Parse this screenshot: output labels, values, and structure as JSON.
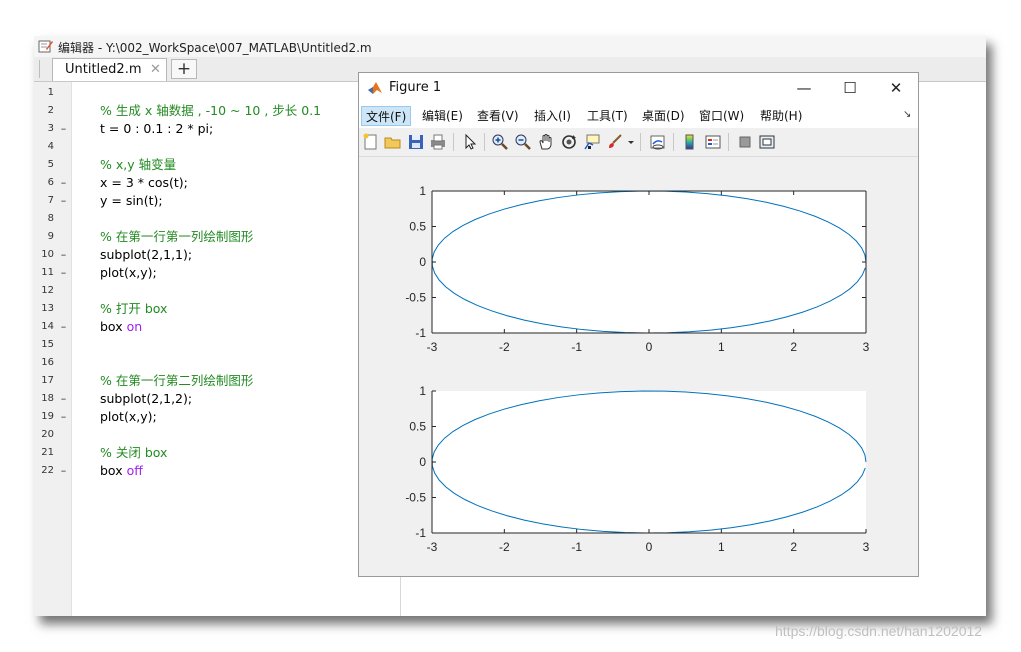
{
  "editor": {
    "title": "编辑器 - Y:\\002_WorkSpace\\007_MATLAB\\Untitled2.m",
    "tab_label": "Untitled2.m",
    "tab_close": "✕",
    "add_tab": "+",
    "lines": [
      {
        "num": "1",
        "mark": "",
        "text": "",
        "kind": "code"
      },
      {
        "num": "2",
        "mark": "",
        "text": "% 生成 x 轴数据 , -10 ~ 10 , 步长 0.1",
        "kind": "comment"
      },
      {
        "num": "3",
        "mark": "–",
        "text": "t = 0 : 0.1 : 2 * pi;",
        "kind": "code"
      },
      {
        "num": "4",
        "mark": "",
        "text": "",
        "kind": "code"
      },
      {
        "num": "5",
        "mark": "",
        "text": "% x,y 轴变量",
        "kind": "comment"
      },
      {
        "num": "6",
        "mark": "–",
        "text": "x = 3 * cos(t);",
        "kind": "code"
      },
      {
        "num": "7",
        "mark": "–",
        "text": "y = sin(t);",
        "kind": "code"
      },
      {
        "num": "8",
        "mark": "",
        "text": "",
        "kind": "code"
      },
      {
        "num": "9",
        "mark": "",
        "text": "% 在第一行第一列绘制图形",
        "kind": "comment"
      },
      {
        "num": "10",
        "mark": "–",
        "text": "subplot(2,1,1);",
        "kind": "code"
      },
      {
        "num": "11",
        "mark": "–",
        "text": "plot(x,y);",
        "kind": "code"
      },
      {
        "num": "12",
        "mark": "",
        "text": "",
        "kind": "code"
      },
      {
        "num": "13",
        "mark": "",
        "text": "% 打开 box",
        "kind": "comment"
      },
      {
        "num": "14",
        "mark": "–",
        "text": "box ",
        "kw": "on",
        "kind": "code"
      },
      {
        "num": "15",
        "mark": "",
        "text": "",
        "kind": "code"
      },
      {
        "num": "16",
        "mark": "",
        "text": "",
        "kind": "code"
      },
      {
        "num": "17",
        "mark": "",
        "text": "% 在第一行第二列绘制图形",
        "kind": "comment"
      },
      {
        "num": "18",
        "mark": "–",
        "text": "subplot(2,1,2);",
        "kind": "code"
      },
      {
        "num": "19",
        "mark": "–",
        "text": "plot(x,y);",
        "kind": "code"
      },
      {
        "num": "20",
        "mark": "",
        "text": "",
        "kind": "code"
      },
      {
        "num": "21",
        "mark": "",
        "text": "% 关闭 box",
        "kind": "comment"
      },
      {
        "num": "22",
        "mark": "–",
        "text": "box ",
        "kw": "off",
        "kind": "code"
      }
    ]
  },
  "figure": {
    "title": "Figure 1",
    "minimize": "—",
    "maximize": "☐",
    "close": "✕",
    "menus": [
      "文件(F)",
      "编辑(E)",
      "查看(V)",
      "插入(I)",
      "工具(T)",
      "桌面(D)",
      "窗口(W)",
      "帮助(H)"
    ],
    "menu_dock": "↘",
    "toolbar_icons": [
      "new-figure-icon",
      "open-icon",
      "save-icon",
      "print-icon",
      "pointer-icon",
      "zoom-in-icon",
      "zoom-out-icon",
      "pan-icon",
      "rotate-3d-icon",
      "data-cursor-icon",
      "brush-icon",
      "brush-dropdown-icon",
      "link-plot-icon",
      "colorbar-icon",
      "legend-icon",
      "hide-plot-tools-icon",
      "show-plot-tools-icon"
    ]
  },
  "colors": {
    "line": "#0072bd",
    "comment": "#228b22",
    "keyword": "#a020f0",
    "axes_bg_box_on": "#ffffff"
  },
  "watermark": "https://blog.csdn.net/han1202012",
  "chart_data": [
    {
      "type": "line",
      "box": "on",
      "series": [
        {
          "equation": "x = 3*cos(t), y = sin(t), t = 0:0.1:2*pi"
        }
      ],
      "xlim": [
        -3,
        3
      ],
      "ylim": [
        -1,
        1
      ],
      "xticks": [
        "-3",
        "-2",
        "-1",
        "0",
        "1",
        "2",
        "3"
      ],
      "yticks": [
        "1",
        "0.5",
        "0",
        "-0.5",
        "-1"
      ]
    },
    {
      "type": "line",
      "box": "off",
      "series": [
        {
          "equation": "x = 3*cos(t), y = sin(t), t = 0:0.1:2*pi"
        }
      ],
      "xlim": [
        -3,
        3
      ],
      "ylim": [
        -1,
        1
      ],
      "xticks": [
        "-3",
        "-2",
        "-1",
        "0",
        "1",
        "2",
        "3"
      ],
      "yticks": [
        "1",
        "0.5",
        "0",
        "-0.5",
        "-1"
      ]
    }
  ]
}
